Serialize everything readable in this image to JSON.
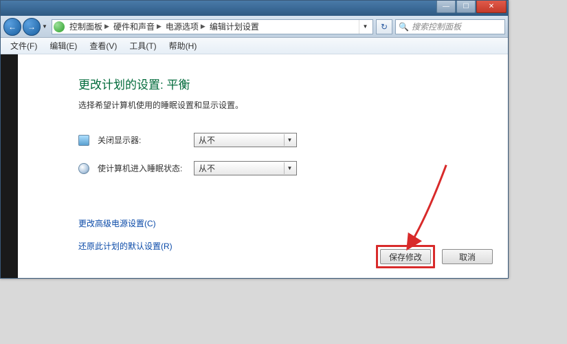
{
  "window": {
    "min": "—",
    "max": "☐",
    "close": "✕"
  },
  "breadcrumb": {
    "root": "控制面板",
    "l1": "硬件和声音",
    "l2": "电源选项",
    "l3": "编辑计划设置"
  },
  "search": {
    "placeholder": "搜索控制面板"
  },
  "menu": {
    "file": "文件(F)",
    "edit": "编辑(E)",
    "view": "查看(V)",
    "tools": "工具(T)",
    "help": "帮助(H)"
  },
  "page": {
    "title": "更改计划的设置: 平衡",
    "subtitle": "选择希望计算机使用的睡眠设置和显示设置。"
  },
  "settings": {
    "display_off_label": "关闭显示器:",
    "display_off_value": "从不",
    "sleep_label": "使计算机进入睡眠状态:",
    "sleep_value": "从不"
  },
  "links": {
    "advanced": "更改高级电源设置(C)",
    "restore": "还原此计划的默认设置(R)"
  },
  "buttons": {
    "save": "保存修改",
    "cancel": "取消"
  }
}
